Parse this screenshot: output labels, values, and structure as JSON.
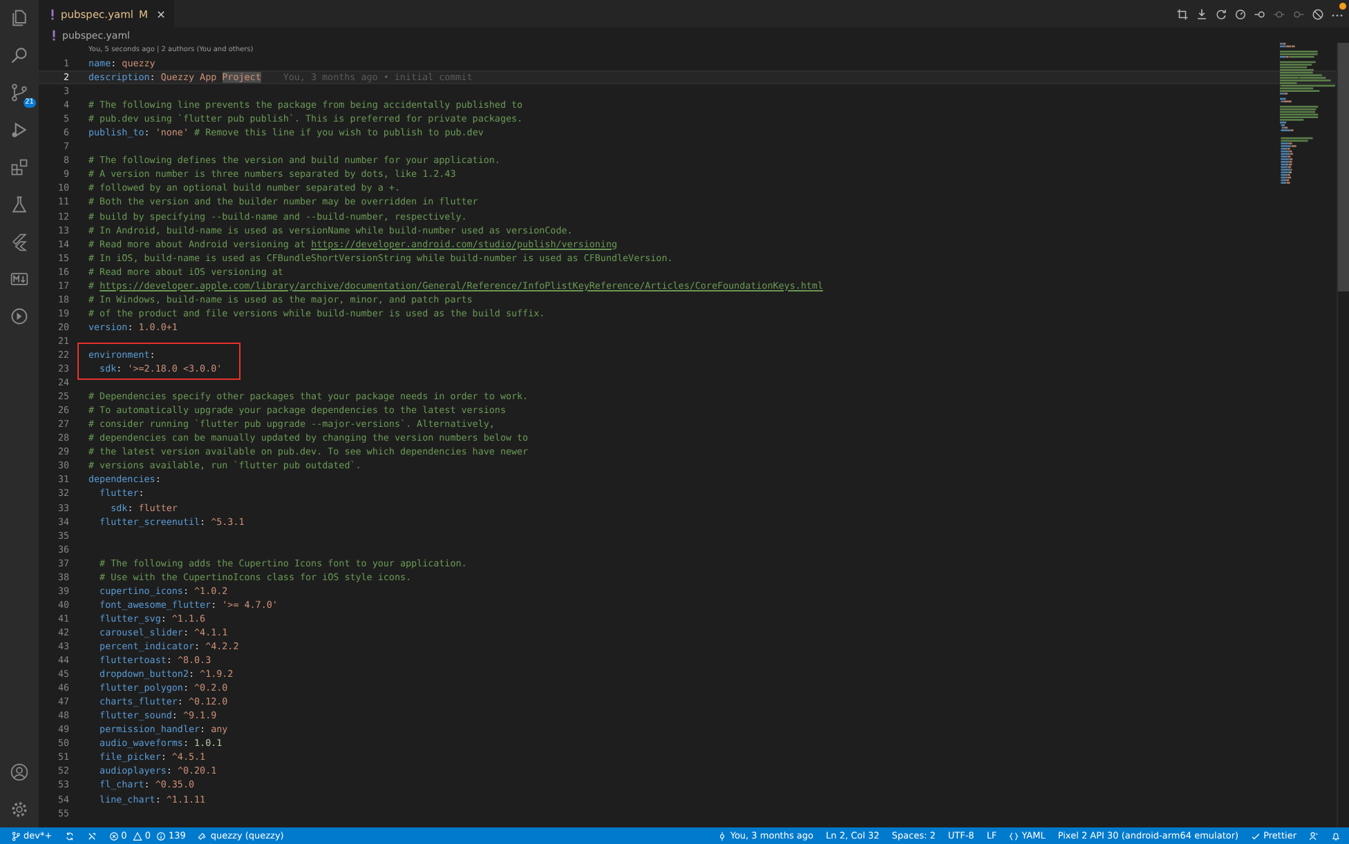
{
  "activity_bar": {
    "source_control_badge": "21"
  },
  "tabs": [
    {
      "label": "pubspec.yaml",
      "badge": "M",
      "selected": true
    }
  ],
  "breadcrumb": "pubspec.yaml",
  "editor": {
    "codelens": "You, 5 seconds ago | 2 authors (You and others)",
    "blocks": [
      {
        "kind": "plain",
        "lines": [
          {
            "n": "1",
            "current": false,
            "tokens": [
              {
                "kind": "key",
                "text": "name"
              },
              {
                "kind": "punct",
                "text": ": "
              },
              {
                "kind": "str",
                "text": "quezzy"
              }
            ]
          },
          {
            "n": "2",
            "current": true,
            "blame": "You, 3 months ago • initial commit",
            "tokens": [
              {
                "kind": "key",
                "text": "description"
              },
              {
                "kind": "punct",
                "text": ": "
              },
              {
                "kind": "str",
                "text": "Quezzy App "
              },
              {
                "kind": "sel",
                "text": "Project"
              }
            ]
          },
          {
            "n": "3",
            "current": false
          },
          {
            "n": "4",
            "current": false,
            "tokens": [
              {
                "kind": "comment",
                "text": "# The following line prevents the package from being accidentally published to"
              }
            ]
          },
          {
            "n": "5",
            "current": false,
            "tokens": [
              {
                "kind": "comment",
                "text": "# pub.dev using `flutter pub publish`. This is preferred for private packages."
              }
            ]
          },
          {
            "n": "6",
            "current": false,
            "tokens": [
              {
                "kind": "key",
                "text": "publish_to"
              },
              {
                "kind": "punct",
                "text": ": "
              },
              {
                "kind": "str",
                "text": "'none'"
              },
              {
                "kind": "comment",
                "text": " # Remove this line if you wish to publish to pub.dev"
              }
            ]
          },
          {
            "n": "7",
            "current": false
          },
          {
            "n": "8",
            "current": false,
            "tokens": [
              {
                "kind": "comment",
                "text": "# The following defines the version and build number for your application."
              }
            ]
          },
          {
            "n": "9",
            "current": false,
            "tokens": [
              {
                "kind": "comment",
                "text": "# A version number is three numbers separated by dots, like 1.2.43"
              }
            ]
          },
          {
            "n": "10",
            "current": false,
            "tokens": [
              {
                "kind": "comment",
                "text": "# followed by an optional build number separated by a +."
              }
            ]
          },
          {
            "n": "11",
            "current": false,
            "tokens": [
              {
                "kind": "comment",
                "text": "# Both the version and the builder number may be overridden in flutter"
              }
            ]
          },
          {
            "n": "12",
            "current": false,
            "tokens": [
              {
                "kind": "comment",
                "text": "# build by specifying --build-name and --build-number, respectively."
              }
            ]
          },
          {
            "n": "13",
            "current": false,
            "tokens": [
              {
                "kind": "comment",
                "text": "# In Android, build-name is used as versionName while build-number used as versionCode."
              }
            ]
          },
          {
            "n": "14",
            "current": false,
            "tokens": [
              {
                "kind": "comment",
                "text": "# Read more about Android versioning at "
              },
              {
                "kind": "link",
                "text": "https://developer.android.com/studio/publish/versioning"
              }
            ]
          },
          {
            "n": "15",
            "current": false,
            "tokens": [
              {
                "kind": "comment",
                "text": "# In iOS, build-name is used as CFBundleShortVersionString while build-number is used as CFBundleVersion."
              }
            ]
          },
          {
            "n": "16",
            "current": false,
            "tokens": [
              {
                "kind": "comment",
                "text": "# Read more about iOS versioning at"
              }
            ]
          },
          {
            "n": "17",
            "current": false,
            "tokens": [
              {
                "kind": "comment",
                "text": "# "
              },
              {
                "kind": "link",
                "text": "https://developer.apple.com/library/archive/documentation/General/Reference/InfoPlistKeyReference/Articles/CoreFoundationKeys.html"
              }
            ]
          },
          {
            "n": "18",
            "current": false,
            "tokens": [
              {
                "kind": "comment",
                "text": "# In Windows, build-name is used as the major, minor, and patch parts"
              }
            ]
          },
          {
            "n": "19",
            "current": false,
            "tokens": [
              {
                "kind": "comment",
                "text": "# of the product and file versions while build-number is used as the build suffix."
              }
            ]
          },
          {
            "n": "20",
            "current": false,
            "tokens": [
              {
                "kind": "key",
                "text": "version"
              },
              {
                "kind": "punct",
                "text": ": "
              },
              {
                "kind": "str",
                "text": "1.0.0+1"
              }
            ]
          },
          {
            "n": "21",
            "current": false
          }
        ]
      },
      {
        "kind": "boxed",
        "lines": [
          {
            "n": "22",
            "current": false,
            "tokens": [
              {
                "kind": "key",
                "text": "environment"
              },
              {
                "kind": "punct",
                "text": ":"
              }
            ]
          },
          {
            "n": "23",
            "current": false,
            "tokens": [
              {
                "kind": "key",
                "text": "  sdk"
              },
              {
                "kind": "punct",
                "text": ": "
              },
              {
                "kind": "str",
                "text": "'>=2.18.0 <3.0.0'"
              }
            ]
          }
        ]
      },
      {
        "kind": "plain",
        "lines": [
          {
            "n": "24",
            "current": false
          },
          {
            "n": "25",
            "current": false,
            "tokens": [
              {
                "kind": "comment",
                "text": "# Dependencies specify other packages that your package needs in order to work."
              }
            ]
          },
          {
            "n": "26",
            "current": false,
            "tokens": [
              {
                "kind": "comment",
                "text": "# To automatically upgrade your package dependencies to the latest versions"
              }
            ]
          },
          {
            "n": "27",
            "current": false,
            "tokens": [
              {
                "kind": "comment",
                "text": "# consider running `flutter pub upgrade --major-versions`. Alternatively,"
              }
            ]
          },
          {
            "n": "28",
            "current": false,
            "tokens": [
              {
                "kind": "comment",
                "text": "# dependencies can be manually updated by changing the version numbers below to"
              }
            ]
          },
          {
            "n": "29",
            "current": false,
            "tokens": [
              {
                "kind": "comment",
                "text": "# the latest version available on pub.dev. To see which dependencies have newer"
              }
            ]
          },
          {
            "n": "30",
            "current": false,
            "tokens": [
              {
                "kind": "comment",
                "text": "# versions available, run `flutter pub outdated`."
              }
            ]
          },
          {
            "n": "31",
            "current": false,
            "tokens": [
              {
                "kind": "key",
                "text": "dependencies"
              },
              {
                "kind": "punct",
                "text": ":"
              }
            ]
          },
          {
            "n": "32",
            "current": false,
            "tokens": [
              {
                "kind": "key",
                "text": "  flutter"
              },
              {
                "kind": "punct",
                "text": ":"
              }
            ]
          },
          {
            "n": "33",
            "current": false,
            "tokens": [
              {
                "kind": "key",
                "text": "    sdk"
              },
              {
                "kind": "punct",
                "text": ": "
              },
              {
                "kind": "str",
                "text": "flutter"
              }
            ]
          },
          {
            "n": "34",
            "current": false,
            "tokens": [
              {
                "kind": "key",
                "text": "  flutter_screenutil"
              },
              {
                "kind": "punct",
                "text": ": "
              },
              {
                "kind": "str",
                "text": "^5.3.1"
              }
            ]
          },
          {
            "n": "35",
            "current": false
          },
          {
            "n": "36",
            "current": false
          },
          {
            "n": "37",
            "current": false,
            "tokens": [
              {
                "kind": "comment",
                "text": "  # The following adds the Cupertino Icons font to your application."
              }
            ]
          },
          {
            "n": "38",
            "current": false,
            "tokens": [
              {
                "kind": "comment",
                "text": "  # Use with the CupertinoIcons class for iOS style icons."
              }
            ]
          },
          {
            "n": "39",
            "current": false,
            "tokens": [
              {
                "kind": "key",
                "text": "  cupertino_icons"
              },
              {
                "kind": "punct",
                "text": ": "
              },
              {
                "kind": "str",
                "text": "^1.0.2"
              }
            ]
          },
          {
            "n": "40",
            "current": false,
            "tokens": [
              {
                "kind": "key",
                "text": "  font_awesome_flutter"
              },
              {
                "kind": "punct",
                "text": ": "
              },
              {
                "kind": "str",
                "text": "'>= 4.7.0'"
              }
            ]
          },
          {
            "n": "41",
            "current": false,
            "tokens": [
              {
                "kind": "key",
                "text": "  flutter_svg"
              },
              {
                "kind": "punct",
                "text": ": "
              },
              {
                "kind": "str",
                "text": "^1.1.6"
              }
            ]
          },
          {
            "n": "42",
            "current": false,
            "tokens": [
              {
                "kind": "key",
                "text": "  carousel_slider"
              },
              {
                "kind": "punct",
                "text": ": "
              },
              {
                "kind": "str",
                "text": "^4.1.1"
              }
            ]
          },
          {
            "n": "43",
            "current": false,
            "tokens": [
              {
                "kind": "key",
                "text": "  percent_indicator"
              },
              {
                "kind": "punct",
                "text": ": "
              },
              {
                "kind": "str",
                "text": "^4.2.2"
              }
            ]
          },
          {
            "n": "44",
            "current": false,
            "tokens": [
              {
                "kind": "key",
                "text": "  fluttertoast"
              },
              {
                "kind": "punct",
                "text": ": "
              },
              {
                "kind": "str",
                "text": "^8.0.3"
              }
            ]
          },
          {
            "n": "45",
            "current": false,
            "tokens": [
              {
                "kind": "key",
                "text": "  dropdown_button2"
              },
              {
                "kind": "punct",
                "text": ": "
              },
              {
                "kind": "str",
                "text": "^1.9.2"
              }
            ]
          },
          {
            "n": "46",
            "current": false,
            "tokens": [
              {
                "kind": "key",
                "text": "  flutter_polygon"
              },
              {
                "kind": "punct",
                "text": ": "
              },
              {
                "kind": "str",
                "text": "^0.2.0"
              }
            ]
          },
          {
            "n": "47",
            "current": false,
            "tokens": [
              {
                "kind": "key",
                "text": "  charts_flutter"
              },
              {
                "kind": "punct",
                "text": ": "
              },
              {
                "kind": "str",
                "text": "^0.12.0"
              }
            ]
          },
          {
            "n": "48",
            "current": false,
            "tokens": [
              {
                "kind": "key",
                "text": "  flutter_sound"
              },
              {
                "kind": "punct",
                "text": ": "
              },
              {
                "kind": "str",
                "text": "^9.1.9"
              }
            ]
          },
          {
            "n": "49",
            "current": false,
            "tokens": [
              {
                "kind": "key",
                "text": "  permission_handler"
              },
              {
                "kind": "punct",
                "text": ": "
              },
              {
                "kind": "str",
                "text": "any"
              }
            ]
          },
          {
            "n": "50",
            "current": false,
            "tokens": [
              {
                "kind": "key",
                "text": "  audio_waveforms"
              },
              {
                "kind": "punct",
                "text": ": "
              },
              {
                "kind": "num",
                "text": "1.0.1"
              }
            ]
          },
          {
            "n": "51",
            "current": false,
            "tokens": [
              {
                "kind": "key",
                "text": "  file_picker"
              },
              {
                "kind": "punct",
                "text": ": "
              },
              {
                "kind": "str",
                "text": "^4.5.1"
              }
            ]
          },
          {
            "n": "52",
            "current": false,
            "tokens": [
              {
                "kind": "key",
                "text": "  audioplayers"
              },
              {
                "kind": "punct",
                "text": ": "
              },
              {
                "kind": "str",
                "text": "^0.20.1"
              }
            ]
          },
          {
            "n": "53",
            "current": false,
            "tokens": [
              {
                "kind": "key",
                "text": "  fl_chart"
              },
              {
                "kind": "punct",
                "text": ": "
              },
              {
                "kind": "str",
                "text": "^0.35.0"
              }
            ]
          },
          {
            "n": "54",
            "current": false,
            "tokens": [
              {
                "kind": "key",
                "text": "  line_chart"
              },
              {
                "kind": "punct",
                "text": ": "
              },
              {
                "kind": "str",
                "text": "^1.1.11"
              }
            ]
          },
          {
            "n": "55",
            "current": false
          }
        ]
      }
    ]
  },
  "status_bar": {
    "branch": "dev*+",
    "errors": "0",
    "warnings": "0",
    "infos": "139",
    "project": "quezzy (quezzy)",
    "blame": "You, 3 months ago",
    "position": "Ln 2, Col 32",
    "indentation": "Spaces: 2",
    "encoding": "UTF-8",
    "eol": "LF",
    "language": "YAML",
    "device": "Pixel 2 API 30 (android-arm64 emulator)",
    "formatter": "Prettier"
  }
}
